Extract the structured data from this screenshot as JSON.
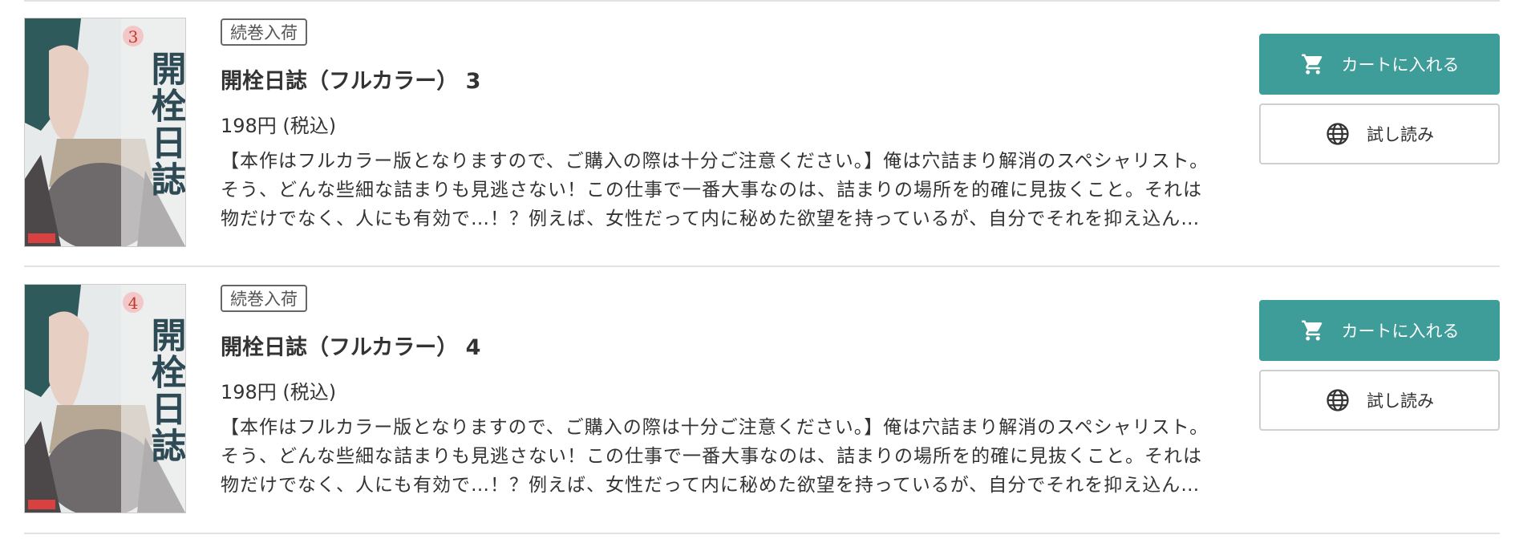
{
  "items": [
    {
      "badge": "続巻入荷",
      "title": "開栓日誌（フルカラー） 3",
      "price": "198円 (税込)",
      "description": [
        "【本作はフルカラー版となりますので、ご購入の際は十分ご注意ください。】俺は穴詰まり解消のスペシャリスト。",
        "そう、どんな些細な詰まりも見逃さない！この仕事で一番大事なのは、詰まりの場所を的確に見抜くこと。それは",
        "物だけでなく、人にも有効で…！？例えば、女性だって内に秘めた欲望を持っているが、自分でそれを抑え込ん…"
      ],
      "cart_label": "カートに入れる",
      "trial_label": "試し読み",
      "cover_volume": "3",
      "cover_title": "開栓日誌",
      "cover_icons": [
        "cart-icon",
        "globe-icon"
      ]
    },
    {
      "badge": "続巻入荷",
      "title": "開栓日誌（フルカラー） 4",
      "price": "198円 (税込)",
      "description": [
        "【本作はフルカラー版となりますので、ご購入の際は十分ご注意ください。】俺は穴詰まり解消のスペシャリスト。",
        "そう、どんな些細な詰まりも見逃さない！この仕事で一番大事なのは、詰まりの場所を的確に見抜くこと。それは",
        "物だけでなく、人にも有効で…！？例えば、女性だって内に秘めた欲望を持っているが、自分でそれを抑え込ん…"
      ],
      "cart_label": "カートに入れる",
      "trial_label": "試し読み",
      "cover_volume": "4",
      "cover_title": "開栓日誌",
      "cover_icons": [
        "cart-icon",
        "globe-icon"
      ]
    }
  ],
  "colors": {
    "accent": "#3e9c99",
    "divider": "#e2e2e2",
    "text": "#333333"
  }
}
